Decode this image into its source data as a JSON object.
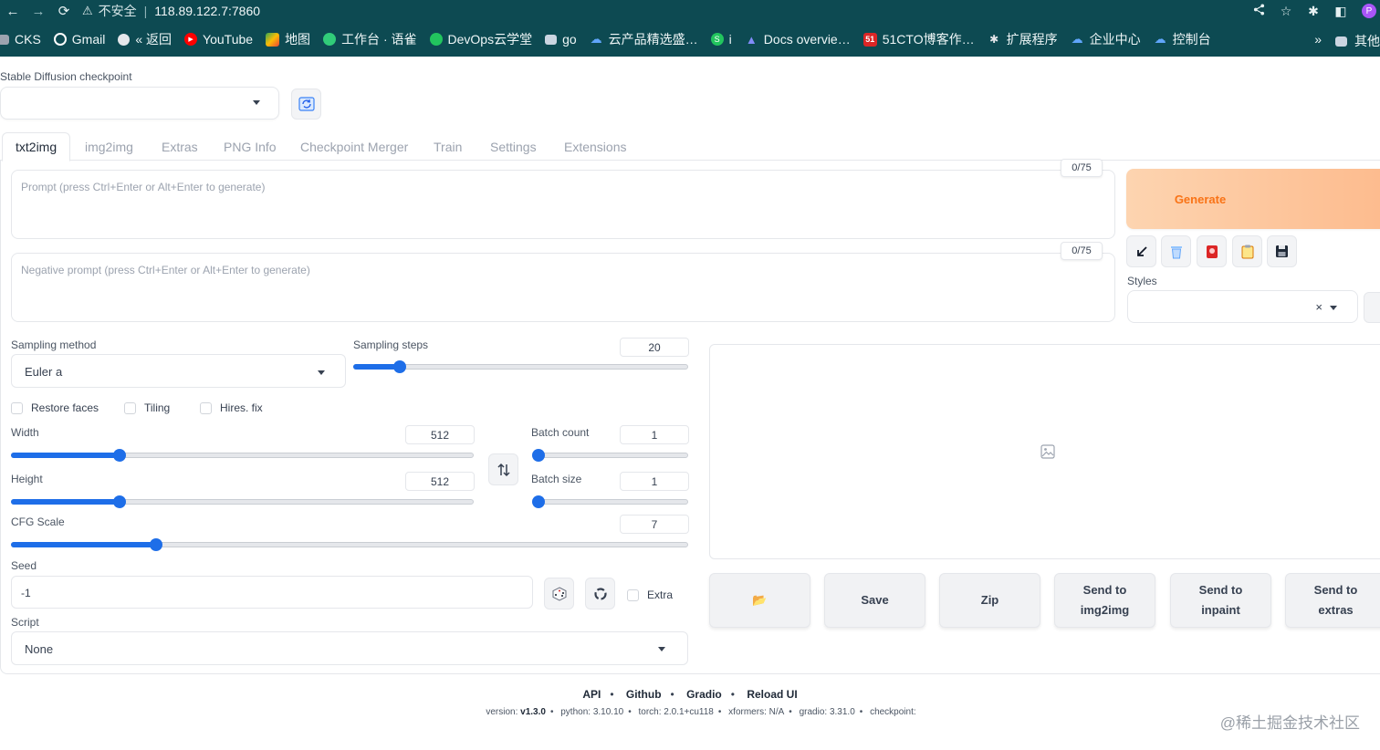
{
  "browser": {
    "insecure_label": "不安全",
    "separator": "|",
    "url": "118.89.122.7:7860",
    "profile_initial": "P",
    "bookmarks": [
      {
        "label": "CKS",
        "color": "#4b5563"
      },
      {
        "label": "Gmail",
        "color": "#ea4335"
      },
      {
        "label": "« 返回",
        "color": "#374151"
      },
      {
        "label": "YouTube",
        "color": "#ff0000"
      },
      {
        "label": "地图",
        "color": "#34a853"
      },
      {
        "label": "工作台 · 语雀",
        "color": "#31cc79"
      },
      {
        "label": "DevOps云学堂",
        "color": "#22c55e"
      },
      {
        "label": "go",
        "color": "#6b7280"
      },
      {
        "label": "云产品精选盛…",
        "color": "#60a5fa"
      },
      {
        "label": "i",
        "color": "#22c55e"
      },
      {
        "label": "Docs overvie…",
        "color": "#6366f1"
      },
      {
        "label": "51CTO博客作…",
        "color": "#dc2626"
      },
      {
        "label": "扩展程序",
        "color": "#e5e7eb"
      },
      {
        "label": "企业中心",
        "color": "#60a5fa"
      },
      {
        "label": "控制台",
        "color": "#60a5fa"
      }
    ],
    "more_label": "»",
    "other_bookmarks_label": "其他"
  },
  "checkpoint": {
    "label": "Stable Diffusion checkpoint",
    "value": ""
  },
  "tabs": [
    {
      "label": "txt2img",
      "active": true
    },
    {
      "label": "img2img"
    },
    {
      "label": "Extras"
    },
    {
      "label": "PNG Info"
    },
    {
      "label": "Checkpoint Merger"
    },
    {
      "label": "Train"
    },
    {
      "label": "Settings"
    },
    {
      "label": "Extensions"
    }
  ],
  "prompt": {
    "placeholder": "Prompt (press Ctrl+Enter or Alt+Enter to generate)",
    "token_count": "0/75"
  },
  "negative_prompt": {
    "placeholder": "Negative prompt (press Ctrl+Enter or Alt+Enter to generate)",
    "token_count": "0/75"
  },
  "generate": {
    "label": "Generate"
  },
  "styles": {
    "label": "Styles",
    "clear": "×"
  },
  "sampling": {
    "method_label": "Sampling method",
    "method_value": "Euler a",
    "steps_label": "Sampling steps",
    "steps_value": "20",
    "steps_fraction": 0.14
  },
  "checkboxes": {
    "restore_faces": "Restore faces",
    "tiling": "Tiling",
    "hires_fix": "Hires. fix",
    "extra": "Extra"
  },
  "width": {
    "label": "Width",
    "value": "512",
    "fraction": 0.234
  },
  "height": {
    "label": "Height",
    "value": "512",
    "fraction": 0.234
  },
  "batch_count": {
    "label": "Batch count",
    "value": "1",
    "fraction": 0.0
  },
  "batch_size": {
    "label": "Batch size",
    "value": "1",
    "fraction": 0.0
  },
  "cfg_scale": {
    "label": "CFG Scale",
    "value": "7",
    "fraction": 0.214
  },
  "seed": {
    "label": "Seed",
    "value": "-1"
  },
  "script": {
    "label": "Script",
    "value": "None"
  },
  "output_buttons": {
    "folder": "📂",
    "save": "Save",
    "zip": "Zip",
    "send_img2img_1": "Send to",
    "send_img2img_2": "img2img",
    "send_inpaint_1": "Send to",
    "send_inpaint_2": "inpaint",
    "send_extras_1": "Send to",
    "send_extras_2": "extras"
  },
  "footer": {
    "links": [
      "API",
      "Github",
      "Gradio",
      "Reload UI"
    ],
    "version_label": "version:",
    "version_value": "v1.3.0",
    "python": "python: 3.10.10",
    "torch": "torch: 2.0.1+cu118",
    "xformers": "xformers: N/A",
    "gradio": "gradio: 3.31.0",
    "checkpoint": "checkpoint:"
  },
  "watermark": "@稀土掘金技术社区"
}
